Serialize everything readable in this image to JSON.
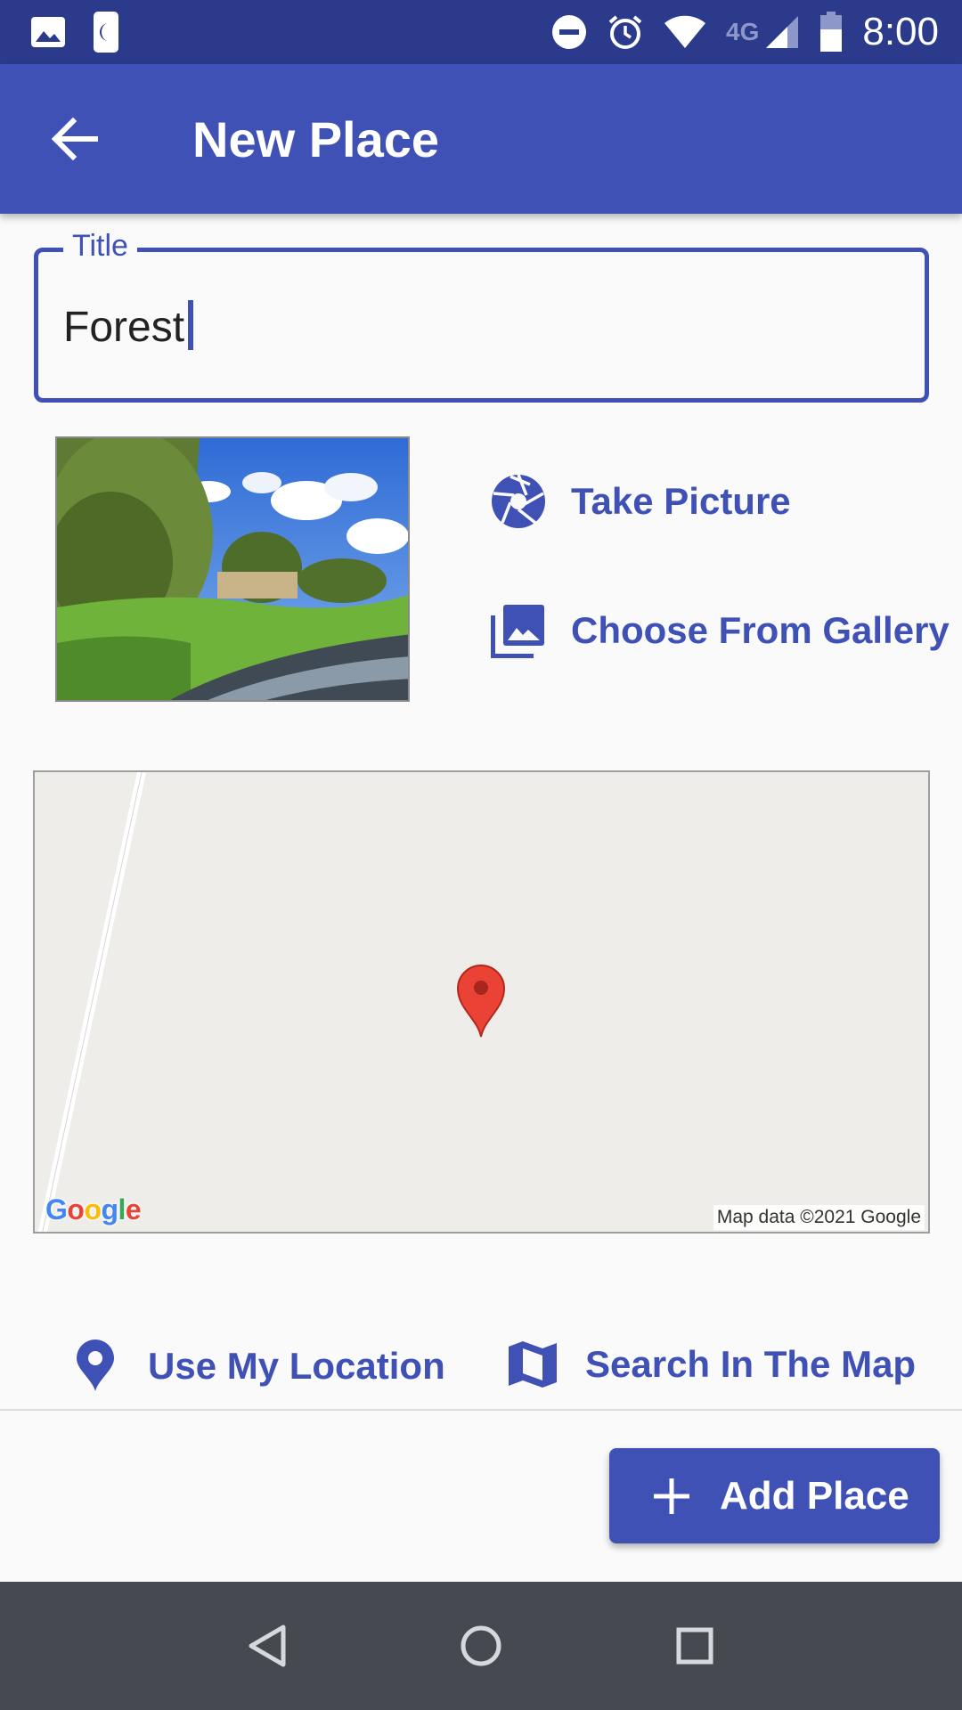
{
  "status_bar": {
    "network": "4G",
    "time": "8:00",
    "icons": [
      "image-icon",
      "moon-icon",
      "do-not-disturb-icon",
      "alarm-icon",
      "wifi-icon",
      "signal-icon",
      "battery-icon"
    ]
  },
  "app_bar": {
    "title": "New Place",
    "back_icon": "arrow-back-icon"
  },
  "title_field": {
    "label": "Title",
    "value": "Forest"
  },
  "image_actions": {
    "take_picture": "Take Picture",
    "choose_from_gallery": "Choose From Gallery",
    "take_picture_icon": "camera-shutter-icon",
    "gallery_icon": "photo-library-icon"
  },
  "map": {
    "attribution": "Map data ©2021 Google",
    "logo_text": "Google",
    "marker_icon": "map-pin-icon"
  },
  "location_actions": {
    "use_my_location": "Use My Location",
    "search_in_map": "Search In The Map",
    "location_icon": "location-pin-icon",
    "map_icon": "map-icon"
  },
  "add_button": {
    "label": "Add Place",
    "icon": "plus-icon"
  },
  "nav_bar": {
    "icons": [
      "back-triangle-icon",
      "home-circle-icon",
      "recents-square-icon"
    ]
  },
  "colors": {
    "primary": "#3f51b5",
    "status_bar": "#2c3a8c",
    "nav_bar": "#464a50",
    "marker": "#ea4335"
  }
}
